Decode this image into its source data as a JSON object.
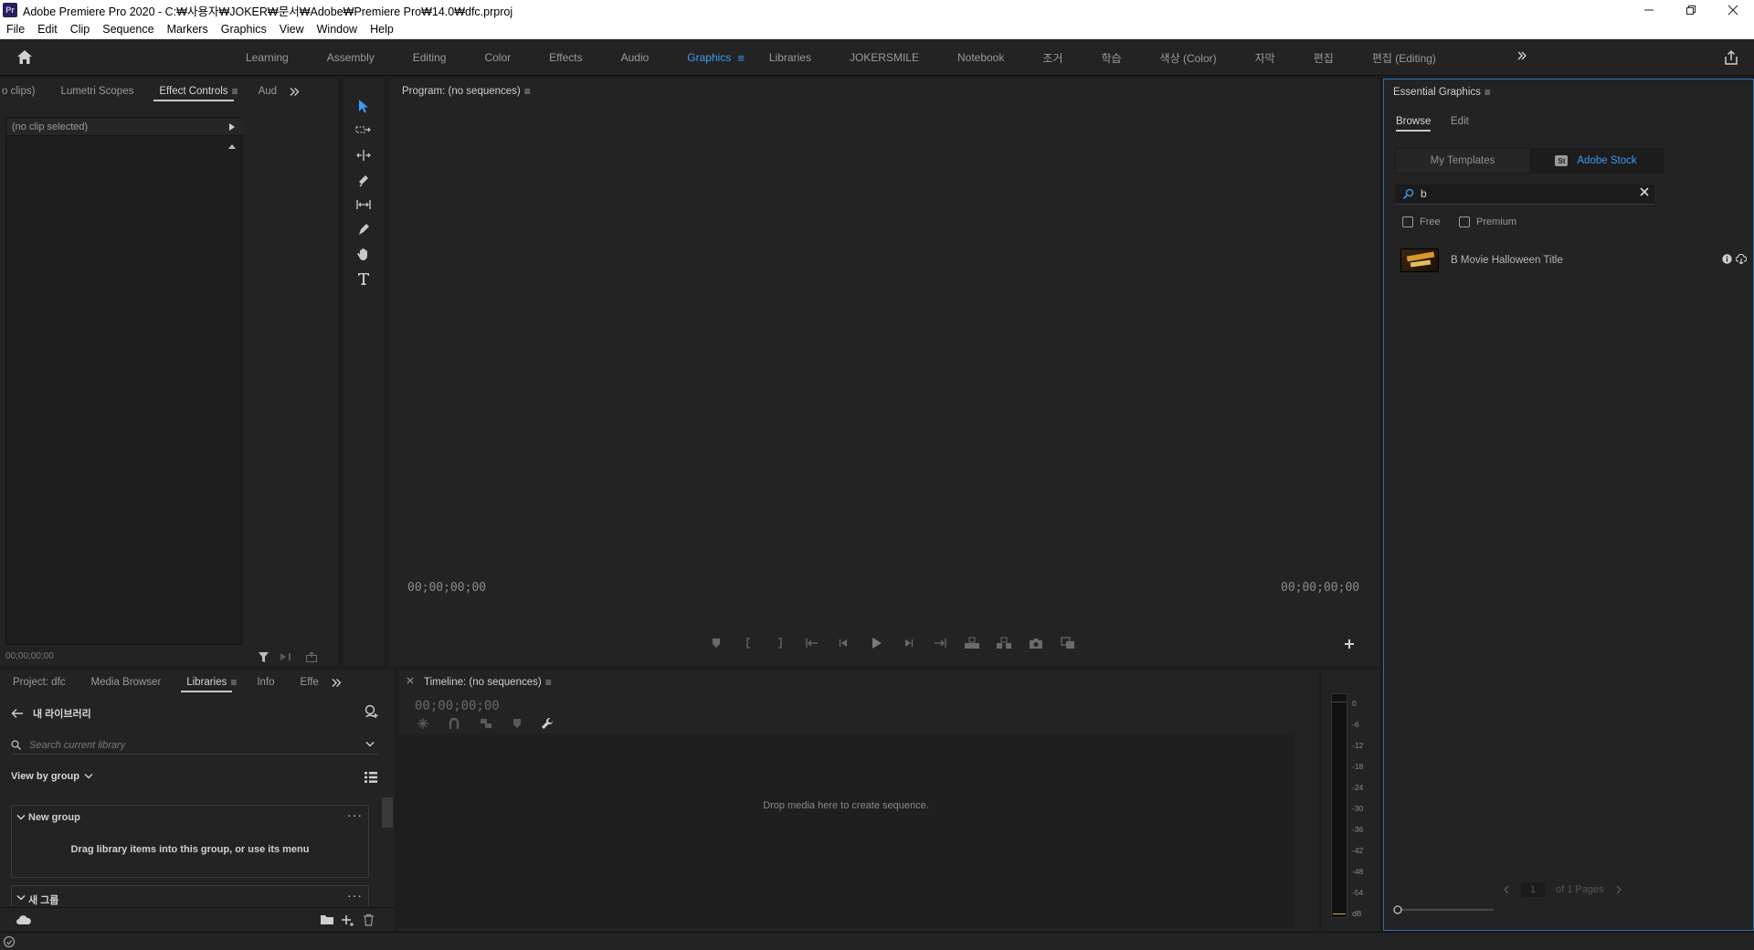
{
  "window": {
    "app_icon_label": "Pr",
    "title": "Adobe Premiere Pro 2020 - C:₩사용자₩JOKER₩문서₩Adobe₩Premiere Pro₩14.0₩dfc.prproj"
  },
  "menubar": {
    "items": [
      "File",
      "Edit",
      "Clip",
      "Sequence",
      "Markers",
      "Graphics",
      "View",
      "Window",
      "Help"
    ]
  },
  "workspaces": {
    "tabs": [
      "Learning",
      "Assembly",
      "Editing",
      "Color",
      "Effects",
      "Audio",
      "Graphics",
      "Libraries",
      "JOKERSMILE",
      "Notebook",
      "조거",
      "학습",
      "색상 (Color)",
      "자막",
      "편집",
      "편집 (Editing)"
    ],
    "active": "Graphics"
  },
  "effect_controls": {
    "tabs": [
      "o clips)",
      "Lumetri Scopes",
      "Effect Controls",
      "Aud"
    ],
    "active_tab": "Effect Controls",
    "header": "(no clip selected)",
    "timecode": "00;00;00;00"
  },
  "program": {
    "title": "Program: (no sequences)",
    "timecode_left": "00;00;00;00",
    "timecode_right": "00;00;00;00"
  },
  "essential_graphics": {
    "title": "Essential Graphics",
    "subtabs": [
      "Browse",
      "Edit"
    ],
    "active_subtab": "Browse",
    "toggle": {
      "left": "My Templates",
      "right": "Adobe Stock",
      "active": "Adobe Stock",
      "stock_badge": "St"
    },
    "search_value": "b",
    "filters": [
      "Free",
      "Premium"
    ],
    "results": [
      {
        "name": "B Movie Halloween Title"
      }
    ],
    "pager": {
      "page": "1",
      "total": "of 1 Pages"
    },
    "accent_color": "#3c9bf2"
  },
  "libraries": {
    "tabs": [
      "Project: dfc",
      "Media Browser",
      "Libraries",
      "Info",
      "Effe"
    ],
    "active_tab": "Libraries",
    "library_name": "내 라이브러리",
    "search_placeholder": "Search current library",
    "view_by": "View by group",
    "groups": [
      {
        "title": "New group",
        "hint": "Drag library items into this group, or use its menu"
      },
      {
        "title": "새 그룹"
      }
    ]
  },
  "timeline": {
    "title": "Timeline: (no sequences)",
    "timecode": "00;00;00;00",
    "drop_hint": "Drop media here to create sequence."
  },
  "audio_meters": {
    "labels": [
      "0",
      "-6",
      "-12",
      "-18",
      "-24",
      "-30",
      "-36",
      "-42",
      "-48",
      "-54",
      "dB"
    ]
  }
}
